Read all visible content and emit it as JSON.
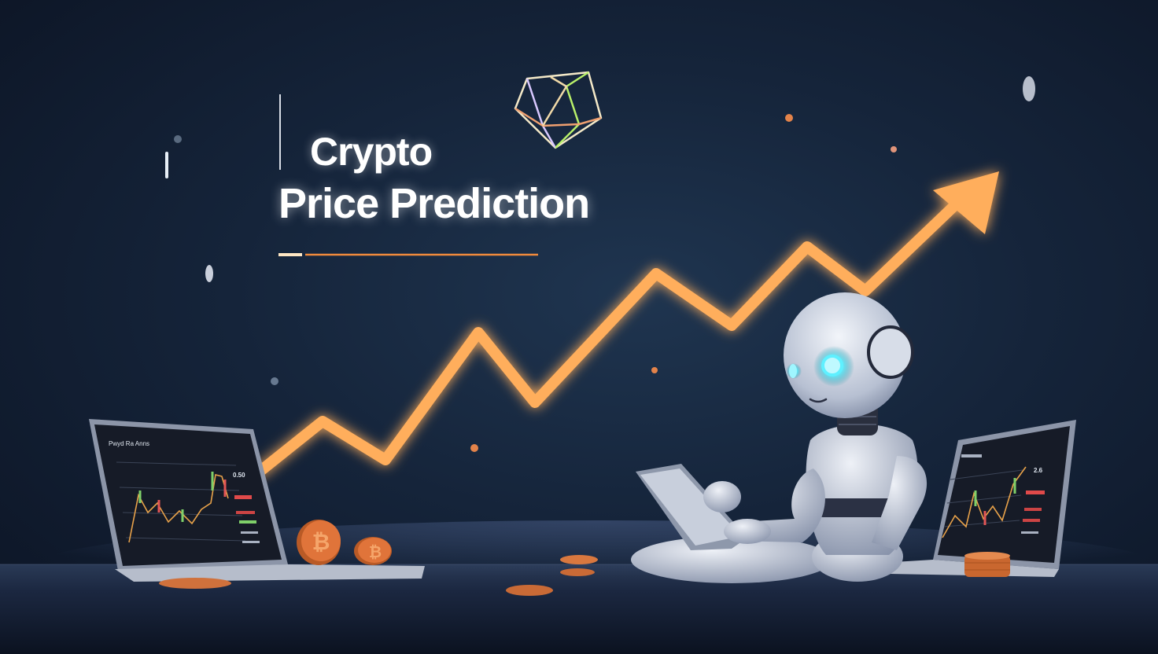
{
  "headline": {
    "line1": "Crypto",
    "line2": "Price Prediction"
  },
  "left_laptop": {
    "screen_title": "Pwyd Ra Anns",
    "price_tag": "0.50"
  },
  "right_laptop": {
    "price_tag": "2.6"
  },
  "colors": {
    "background": "#15243a",
    "trend_arrow": "#ffa64d",
    "accent_line": "#f08a3c",
    "robot_eye": "#5ff0ff",
    "coin": "#e0743a"
  },
  "icons": [
    "gem-icon",
    "bitcoin-coin-icon",
    "trend-arrow-icon",
    "robot"
  ]
}
